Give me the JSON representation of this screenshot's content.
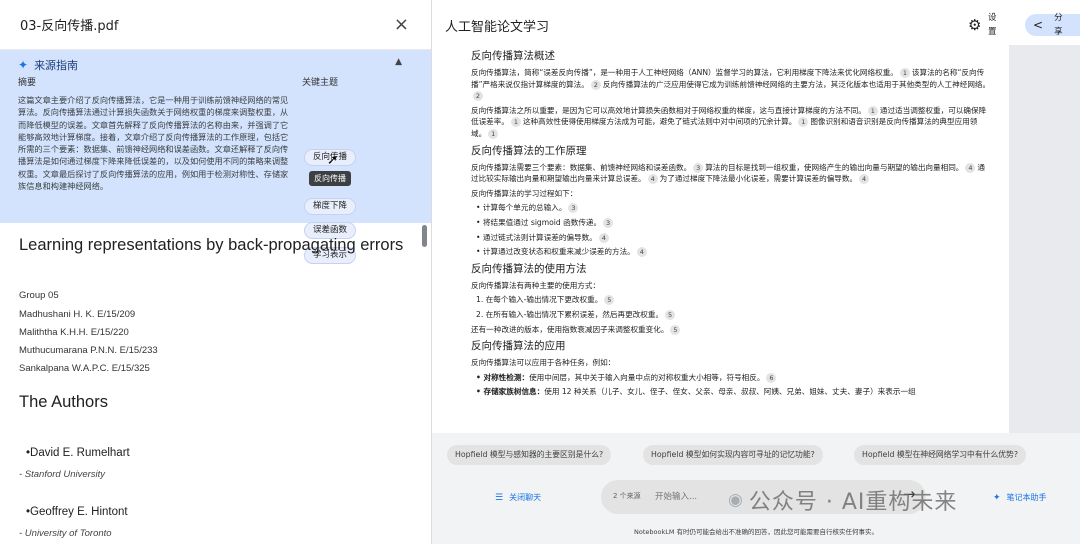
{
  "source_panel": {
    "file_title": "03-反向传播.pdf",
    "close_icon": "×"
  },
  "guide": {
    "title": "来源指南",
    "summary_label": "摘要",
    "summary": "这篇文章主要介绍了反向传播算法，它是一种用于训练前馈神经网络的常见算法。反向传播算法通过计算损失函数关于网络权重的梯度来调整权重，从而降低模型的误差。文章首先解释了反向传播算法的名称由来，并强调了它能够高效地计算梯度。接着，文章介绍了反向传播算法的工作原理，包括它所需的三个要素：数据集、前馈神经网络和误差函数。文章还解释了反向传播算法是如何通过梯度下降来降低误差的，以及如何使用不同的策略来调整权重。文章最后探讨了反向传播算法的应用，例如用于检测对称性、存储家族信息和构建神经网络。",
    "topics_label": "关键主题",
    "topics": [
      "反向传播",
      "梯度下降",
      "误差函数",
      "学习表示"
    ],
    "tooltip": "反向传播"
  },
  "document": {
    "title": "Learning representations by back-propagating errors",
    "group": "Group 05",
    "members": [
      "Madhushani H. K. E/15/209",
      "Maliththa K.H.H. E/15/220",
      "Muthucumarana P.N.N. E/15/233",
      "Sankalpana W.A.P.C. E/15/325"
    ],
    "authors_heading": "The Authors",
    "authors": [
      {
        "name": "•David E. Rumelhart",
        "affiliation": "- Stanford University"
      },
      {
        "name": "•Geoffrey E. Hintont",
        "affiliation": "- University of Toronto"
      }
    ]
  },
  "notes_panel": {
    "title": "人工智能论文学习",
    "settings_label": "设置",
    "share_label": "分享"
  },
  "note": {
    "h1": "反向传播算法概述",
    "p1a": "反向传播算法，简称“误差反向传播”，是一种用于人工神经网络（ANN）监督学习的算法，它利用梯度下降法来优化网络权重。",
    "p1b": "该算法的名称“反向传播”严格来说仅指计算梯度的算法。",
    "p1c": "反向传播算法的广泛应用使得它成为训练前馈神经网络的主要方法，其泛化版本也适用于其他类型的人工神经网络。",
    "p2a": "反向传播算法之所以重要，是因为它可以高效地计算损失函数相对于网络权重的梯度，这与直接计算梯度的方法不同。",
    "p2b": "通过适当调整权重，可以确保降低误差率。",
    "p2c": "这种高效性使得使用梯度方法成为可能，避免了链式法则中对中间项的冗余计算。",
    "p2d": "图像识别和语音识别是反向传播算法的典型应用领域。",
    "h2": "反向传播算法的工作原理",
    "p3a": "反向传播算法需要三个要素：数据集、前馈神经网络和误差函数。",
    "p3b": "算法的目标是找到一组权重，使网络产生的输出向量与期望的输出向量相同。",
    "p3c": "通过比较实际输出向量和期望输出向量来计算总误差。",
    "p3d": "为了通过梯度下降法最小化误差，需要计算误差的偏导数。",
    "p4": "反向传播算法的学习过程如下：",
    "steps": [
      "• 计算每个单元的总输入。",
      "• 将结果值通过 sigmoid 函数传递。",
      "• 通过链式法则计算误差的偏导数。",
      "• 计算通过改变状态和权重来减少误差的方法。"
    ],
    "step_cites": [
      "3",
      "3",
      "4",
      "4"
    ],
    "h3": "反向传播算法的使用方法",
    "p5": "反向传播算法有两种主要的使用方式：",
    "uses": [
      "1. 在每个输入-输出情况下更改权重。",
      "2. 在所有输入-输出情况下累积误差，然后再更改权重。"
    ],
    "p6": "还有一种改进的版本，使用指数衰减因子来调整权重变化。",
    "h4": "反向传播算法的应用",
    "p7": "反向传播算法可以应用于各种任务，例如：",
    "app1_bold": "• 对称性检测：",
    "app1": "使用中间层，其中关于输入向量中点的对称权重大小相等，符号相反。",
    "app2_bold": "• 存储家族树信息：",
    "app2": "使用 12 种关系（儿子、女儿、侄子、侄女、父亲、母亲、叔叔、阿姨、兄弟、姐妹、丈夫、妻子）来表示一组",
    "cites": [
      "1",
      "2",
      "2",
      "1",
      "1",
      "1",
      "3",
      "4",
      "4",
      "5",
      "5",
      "5",
      "6"
    ]
  },
  "chat": {
    "suggestions": [
      "Hopfield 模型与感知器的主要区别是什么?",
      "Hopfield 模型如何实现内容可寻址的记忆功能?",
      "Hopfield 模型在神经网络学习中有什么优势?"
    ],
    "close_chat": "关闭聊天",
    "source_count": "2 个来源",
    "input_placeholder": "开始输入...",
    "notes_button": "笔记本助手",
    "disclaimer": "NotebookLM 有时仍可能会给出不准确的回答，因此您可能需要自行核实任何事实。"
  },
  "watermark": {
    "text": "公众号 · AI重构未来"
  },
  "colors": {
    "guide_bg": "#d3e3fd",
    "accent": "#1a73e8",
    "chat_bg": "#f1f3f4"
  }
}
